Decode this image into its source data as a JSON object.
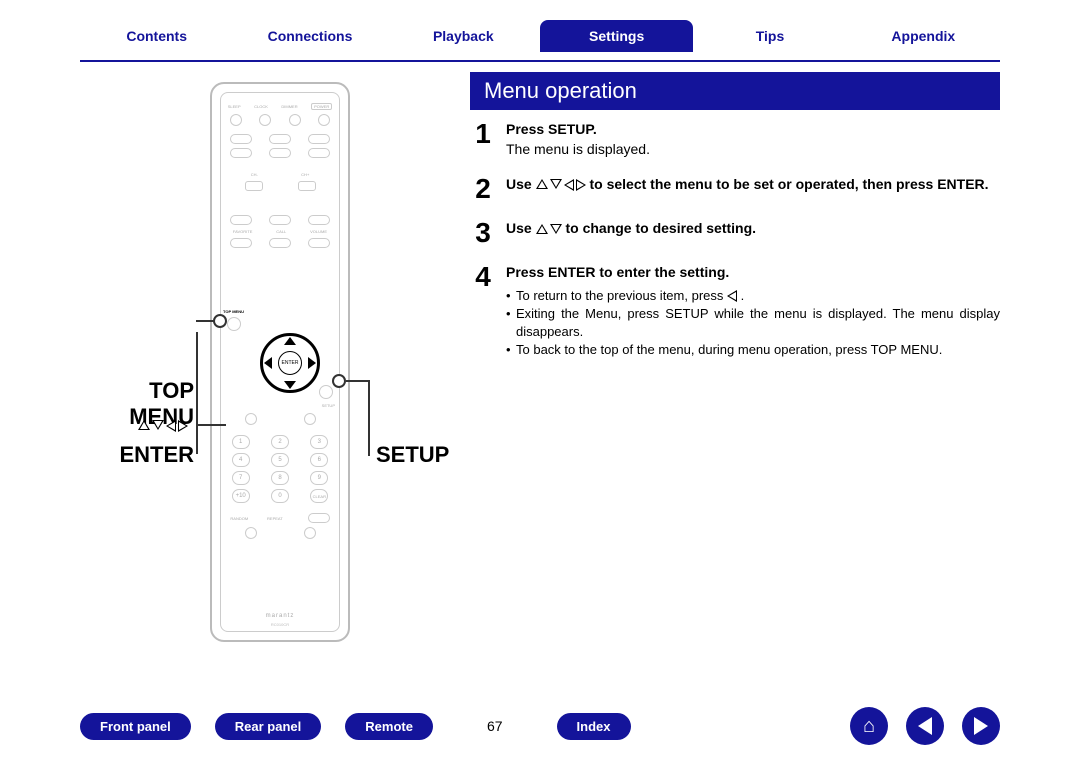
{
  "tabs": [
    "Contents",
    "Connections",
    "Playback",
    "Settings",
    "Tips",
    "Appendix"
  ],
  "active_tab_index": 3,
  "section_title": "Menu operation",
  "labels": {
    "top_menu": "TOP MENU",
    "enter": "ENTER",
    "setup": "SETUP"
  },
  "remote": {
    "enter_btn": "ENTER",
    "topmenu_btn": "TOP MENU",
    "setup_btn": "SETUP",
    "brand": "marantz",
    "model": "RC010CR"
  },
  "steps": [
    {
      "num": "1",
      "title": "Press SETUP.",
      "sub": "The menu is displayed."
    },
    {
      "num": "2",
      "title_parts": [
        "Use ",
        " to select the menu to be set or operated, then press ENTER."
      ],
      "arrows": "udlr"
    },
    {
      "num": "3",
      "title_parts": [
        "Use ",
        " to change to desired setting."
      ],
      "arrows": "ud"
    },
    {
      "num": "4",
      "title": "Press ENTER to enter the setting.",
      "bullets": [
        {
          "pre": "To return to the previous item, press ",
          "arrow": "l",
          "post": "."
        },
        {
          "text": "Exiting the Menu, press SETUP while the menu is displayed. The menu display disappears."
        },
        {
          "text": "To back to the top of the menu, during menu operation, press TOP MENU."
        }
      ]
    }
  ],
  "bottom_links": [
    "Front panel",
    "Rear panel",
    "Remote",
    "Index"
  ],
  "page_number": "67"
}
